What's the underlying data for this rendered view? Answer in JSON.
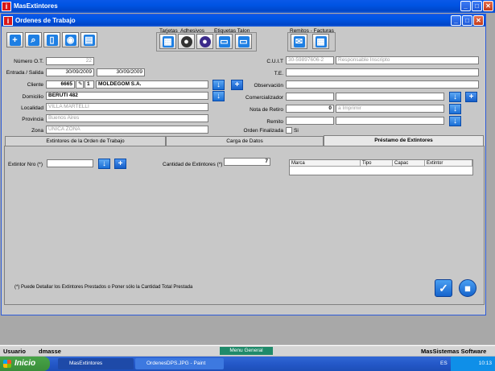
{
  "outer_title": "MasExtintores",
  "child_title": "Ordenes de Trabajo",
  "toolbar_groups": {
    "tarjetas": "Tarjetas",
    "adhesivos": "Adhesivos",
    "etiquetas_talon": "Etiquetas Talon",
    "remitos_facturas": "Remitos - Facturas"
  },
  "form": {
    "numero_ot_label": "Número O.T.",
    "numero_ot": "22",
    "entrada_label": "Entrada / Salida",
    "entrada": "30/09/2009",
    "salida": "30/09/2009",
    "cliente_label": "Cliente",
    "cliente_code": "6665",
    "cliente_sub": "1",
    "cliente_name": "MOLDEGOM S.A.",
    "domicilio_label": "Domicilio",
    "domicilio": "BERUTI 482",
    "localidad_label": "Localidad",
    "localidad": "VILLA MARTELLI",
    "provincia_label": "Provincia",
    "provincia": "Buenos Aires",
    "zona_label": "Zona",
    "zona": "UNICA ZONA",
    "cuit_label": "C.U.I.T",
    "cuit": "30-59897606-2",
    "iva": "Responsable Inscripto",
    "te_label": "T.E.",
    "observacion_label": "Observación",
    "comercializador_label": "Comercializador",
    "nota_retiro_label": "Nota de Retiro",
    "nota_retiro_num": "0",
    "nota_retiro_text": "a Imprimir",
    "remito_label": "Remito",
    "orden_finalizada_label": "Orden Finalizada",
    "si_label": "Si"
  },
  "tabs": [
    "Extintores de la Orden de Trabajo",
    "Carga de Datos",
    "Préstamo de Extintores"
  ],
  "prestamo": {
    "extintor_label": "Extintor Nro (*)",
    "cantidad_label": "Cantidad de Extintores (*)",
    "cantidad": "7",
    "grid_headers": [
      "Marca",
      "Tipo",
      "Capac",
      "Extintor"
    ],
    "note": "(*) Puede Detallar los Extintores Prestados  o Poner sólo la Cantidad Total Prestada"
  },
  "status": {
    "usuario_label": "Usuario",
    "usuario": "dmasse",
    "menu_general": "Menu General",
    "company": "MasSistemas Software"
  },
  "taskbar": {
    "start": "Inicio",
    "task1": "MasExtintores",
    "task2": "OrdenesDPS.JPG - Paint",
    "lang": "ES",
    "clock": "10:13"
  }
}
